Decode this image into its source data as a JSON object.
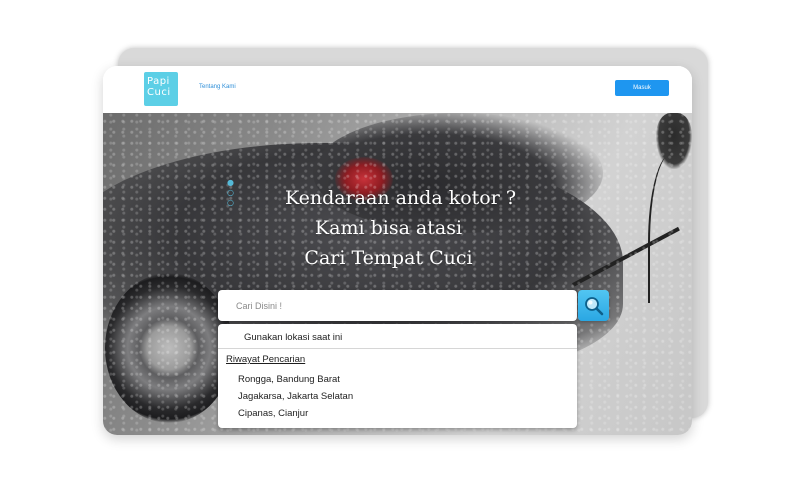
{
  "header": {
    "logo_line1": "Papi",
    "logo_line2": "Cuci",
    "nav_about": "Tentang Kami",
    "login_label": "Masuk"
  },
  "hero": {
    "headline_line1": "Kendaraan anda kotor ?",
    "headline_line2": "Kami bisa atasi",
    "headline_line3": "Cari Tempat Cuci"
  },
  "search": {
    "placeholder": "Cari Disini !",
    "value": ""
  },
  "dropdown": {
    "use_location_label": "Gunakan lokasi saat ini",
    "history_title": "Riwayat Pencarian",
    "history": [
      {
        "label": "Rongga, Bandung Barat"
      },
      {
        "label": "Jagakarsa, Jakarta Selatan"
      },
      {
        "label": "Cipanas, Cianjur"
      }
    ]
  },
  "colors": {
    "brand": "#5ccfe6",
    "primary_button": "#1e96f0",
    "search_button": "#2aa7e3"
  }
}
